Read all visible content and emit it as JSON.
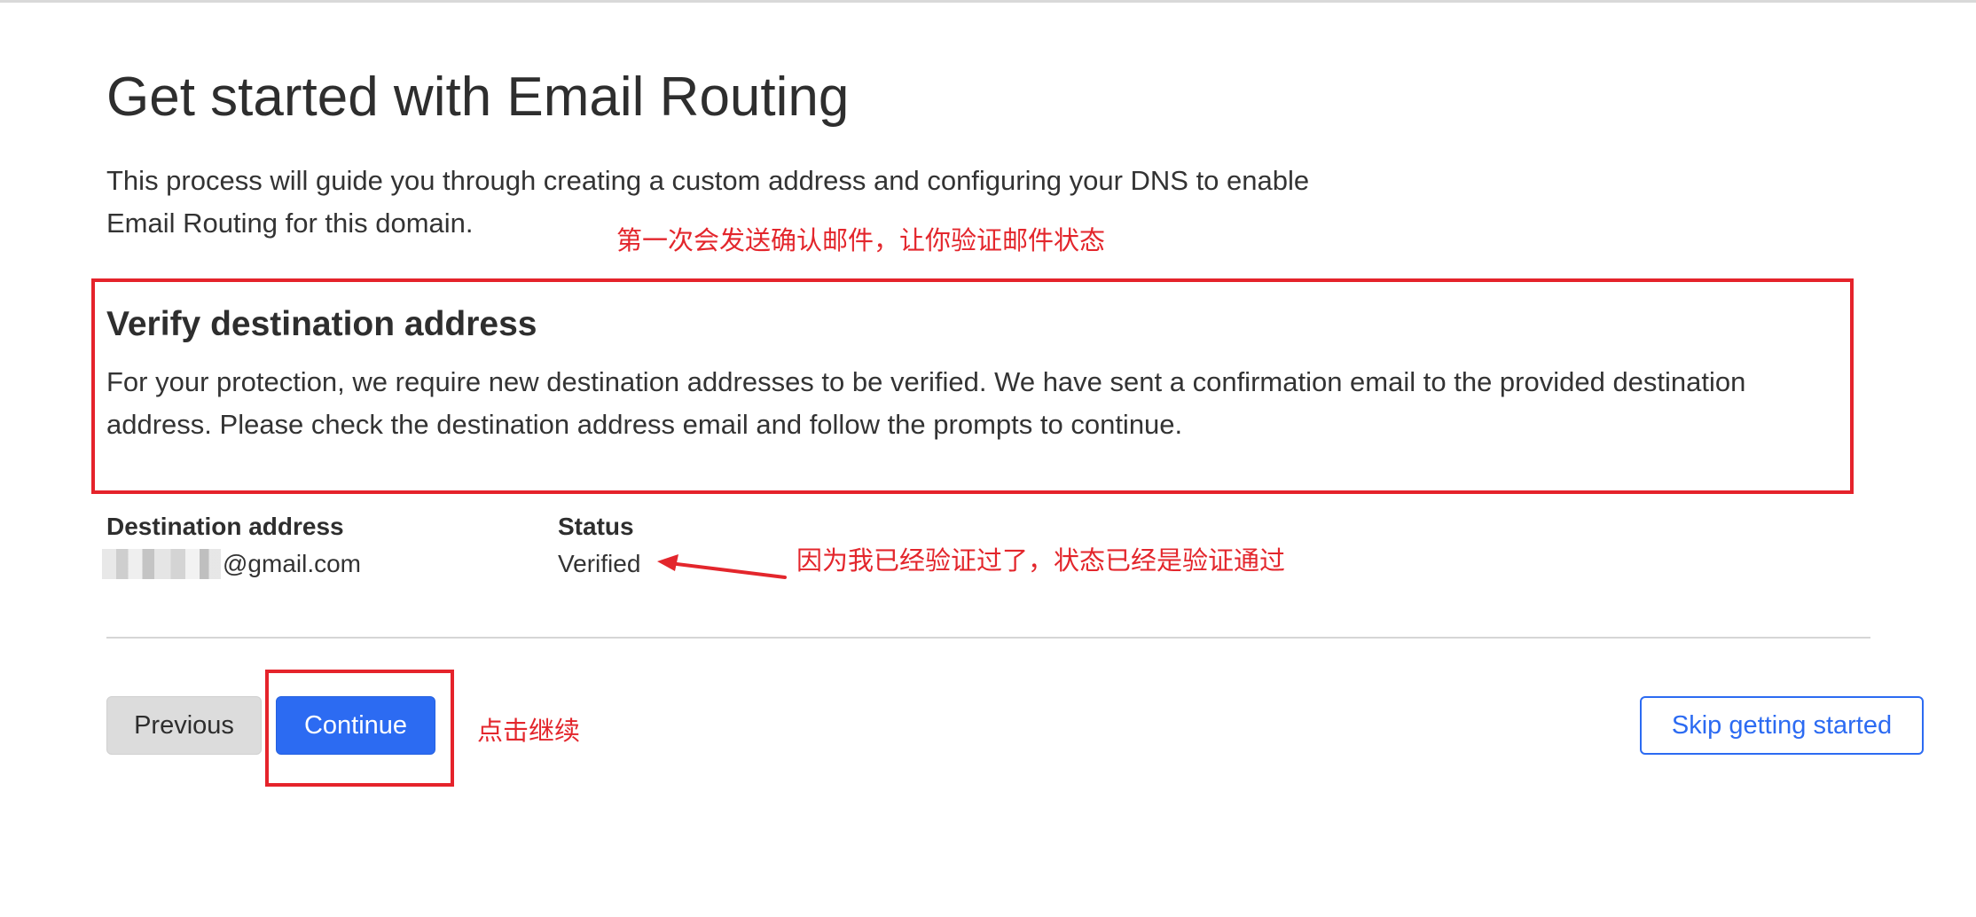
{
  "page": {
    "title": "Get started with Email Routing",
    "intro": "This process will guide you through creating a custom address and configuring your DNS to enable Email Routing for this domain."
  },
  "verify": {
    "heading": "Verify destination address",
    "text": "For your protection, we require new destination addresses to be verified. We have sent a confirmation email to the provided destination address. Please check the destination address email and follow the prompts to continue."
  },
  "destination": {
    "address_label": "Destination address",
    "address_value": "@gmail.com",
    "status_label": "Status",
    "status_value": "Verified"
  },
  "buttons": {
    "previous": "Previous",
    "continue": "Continue",
    "skip": "Skip getting started"
  },
  "annotations": {
    "note_confirm_email": "第一次会发送确认邮件，让你验证邮件状态",
    "note_verified": "因为我已经验证过了，状态已经是验证通过",
    "note_click_continue": "点击继续"
  },
  "colors": {
    "primary": "#2c6bf2",
    "annotation": "#e3262c"
  }
}
